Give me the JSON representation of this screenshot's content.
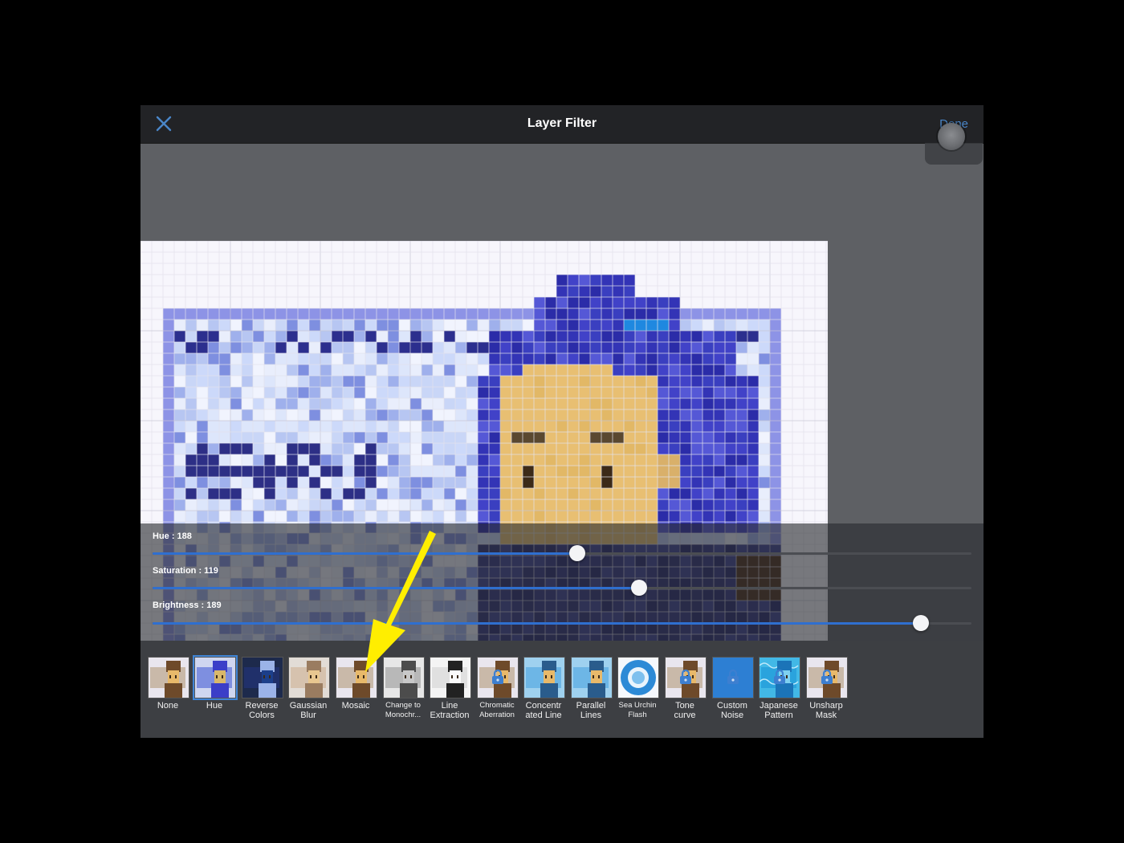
{
  "header": {
    "title": "Layer Filter",
    "done_label": "Done"
  },
  "sliders": [
    {
      "label": "Hue : 188",
      "fraction": 0.519
    },
    {
      "label": "Saturation : 119",
      "fraction": 0.594
    },
    {
      "label": "Brightness : 189",
      "fraction": 0.938
    }
  ],
  "filters": [
    {
      "name": "None",
      "style": "normal",
      "locked": false,
      "selected": false
    },
    {
      "name": "Hue",
      "style": "hue",
      "locked": false,
      "selected": true
    },
    {
      "name": "Reverse\nColors",
      "style": "reverse",
      "locked": false,
      "selected": false
    },
    {
      "name": "Gaussian\nBlur",
      "style": "blur",
      "locked": false,
      "selected": false
    },
    {
      "name": "Mosaic",
      "style": "normal",
      "locked": false,
      "selected": false
    },
    {
      "name": "Change to\nMonochr...",
      "style": "mono",
      "locked": false,
      "selected": false,
      "small": true
    },
    {
      "name": "Line\nExtraction",
      "style": "line",
      "locked": false,
      "selected": false
    },
    {
      "name": "Chromatic\nAberration",
      "style": "normal",
      "locked": true,
      "selected": false,
      "small": true
    },
    {
      "name": "Concentr\nated Line",
      "style": "blue",
      "locked": false,
      "selected": false
    },
    {
      "name": "Parallel\nLines",
      "style": "blue",
      "locked": false,
      "selected": false
    },
    {
      "name": "Sea Urchin\nFlash",
      "style": "urchin",
      "locked": false,
      "selected": false,
      "small": true
    },
    {
      "name": "Tone\ncurve",
      "style": "normal",
      "locked": true,
      "selected": false
    },
    {
      "name": "Custom\nNoise",
      "style": "solidblue",
      "locked": true,
      "selected": false
    },
    {
      "name": "Japanese\nPattern",
      "style": "pattern",
      "locked": true,
      "selected": false
    },
    {
      "name": "Unsharp\nMask",
      "style": "normal",
      "locked": true,
      "selected": false
    }
  ],
  "colors": {
    "accent": "#2f6fcf",
    "done": "#4a86c8",
    "annotation": "#ffee00"
  }
}
